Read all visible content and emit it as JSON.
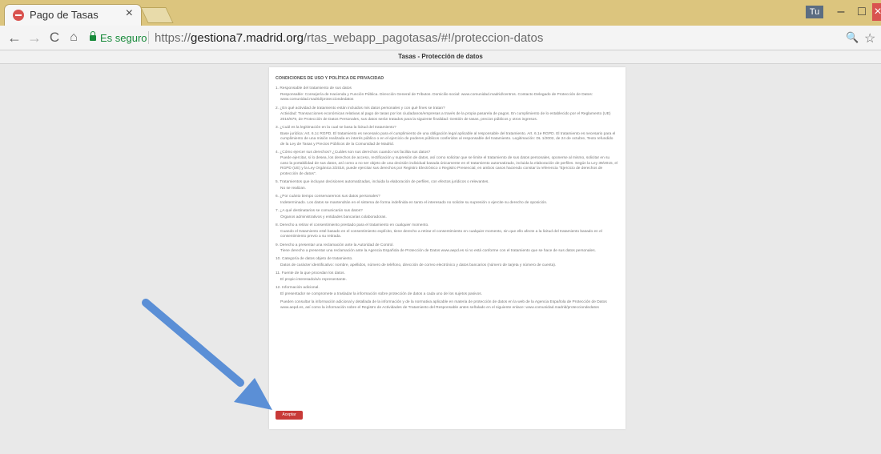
{
  "browser": {
    "tab_title": "Pago de Tasas",
    "tab_close": "×",
    "profile_label": "Tu",
    "window_minimize": "–",
    "window_maximize": "□",
    "window_close": "×",
    "nav": {
      "back": "←",
      "forward": "→",
      "reload": "C",
      "home": "⌂"
    },
    "secure_label": "Es seguro",
    "url_scheme": "https://",
    "url_host": "gestiona7.madrid.org",
    "url_path": "/rtas_webapp_pagotasas/#!/proteccion-datos",
    "zoom_icon": "🔍",
    "star_icon": "☆"
  },
  "page": {
    "header": "Tasas - Protección de datos",
    "doc_title": "CONDICIONES DE USO Y POLÍTICA DE PRIVACIDAD",
    "sections": [
      {
        "q": "1. Responsable del tratamiento de sus datos",
        "a": "Responsable: Consejería de Hacienda y Función Pública. Dirección General de Tributos. Domicilio social: www.comunidad.madrid/centros. Contacto Delegado de Protección de Datos: www.comunidad.madrid/protecciondedatos"
      },
      {
        "q": "2. ¿En qué actividad de tratamiento están incluidos mis datos personales y con qué fines se tratan?",
        "a": "Actividad: Transacciones económicas relativas al pago de tasas por los ciudadanos/empresas a través de la propia pasarela de pagos. En cumplimiento de lo establecido por el Reglamento (UE) 2016/679, de Protección de Datos Personales, sus datos serán tratados para la siguiente finalidad: Gestión de tasas, precios públicos y otros ingresos."
      },
      {
        "q": "3. ¿Cuál es la legitimación en la cual se basa la licitud del tratamiento?",
        "a": "Base jurídica: Art. 6.1c RGPD. El tratamiento es necesario para el cumplimiento de una obligación legal aplicable al responsable del tratamiento. Art. 6.1e RGPD. El tratamiento es necesario para el cumplimiento de una misión realizada en interés público o en el ejercicio de poderes públicos conferidos al responsable del tratamiento. Legitimación: DL 1/2002, de 24 de octubre, Texto refundido de la Ley de Tasas y Precios Públicos de la Comunidad de Madrid."
      },
      {
        "q": "4. ¿Cómo ejercer sus derechos? ¿Cuáles son sus derechos cuando nos facilita sus datos?",
        "a": "Puede ejercitar, si lo desea, los derechos de acceso, rectificación y supresión de datos, así como solicitar que se limite el tratamiento de sus datos personales, oponerse al mismo, solicitar en su caso la portabilidad de sus datos, así como a no ser objeto de una decisión individual basada únicamente en el tratamiento automatizado, incluida la elaboración de perfiles. Según la Ley 39/2015, el RGPD (UE) y la Ley Orgánica 3/2018, puede ejercitar sus derechos por Registro Electrónico o Registro Presencial, en ambos casos haciendo constar la referencia \"Ejercicio de derechos de protección de datos\"."
      },
      {
        "q": "5. Tratamientos que incluyan decisiones automatizadas, incluida la elaboración de perfiles, con efectos jurídicos o relevantes.",
        "a": "No se realizan."
      },
      {
        "q": "6. ¿Por cuánto tiempo conservaremos sus datos personales?",
        "a": "Indeterminado. Los datos se mantendrán en el sistema de forma indefinida en tanto el interesado no solicite su supresión o ejercite su derecho de oposición."
      },
      {
        "q": "7. ¿A qué destinatarios se comunicarán sus datos?",
        "a": "Órganos administrativos y entidades bancarias colaboradoras."
      },
      {
        "q": "8. Derecho a retirar el consentimiento prestado para el tratamiento en cualquier momento.",
        "a": "Cuando el tratamiento esté basado en el consentimiento explícito, tiene derecho a retirar el consentimiento en cualquier momento, sin que ello afecte a la licitud del tratamiento basado en el consentimiento previo a su retirada."
      },
      {
        "q": "9. Derecho a presentar una reclamación ante la Autoridad de Control.",
        "a": "Tiene derecho a presentar una reclamación ante la Agencia Española de Protección de Datos www.aepd.es si no está conforme con el tratamiento que se hace de sus datos personales."
      },
      {
        "q": "10. Categoría de datos objeto de tratamiento.",
        "a": "Datos de carácter identificativo: nombre, apellidos, número de teléfono, dirección de correo electrónico y datos bancarios (número de tarjeta y número de cuenta)."
      },
      {
        "q": "11. Fuente de la que procedan los datos.",
        "a": "El propio interesado/a/o representante."
      },
      {
        "q": "12. Información adicional.",
        "a": "El presentador se compromete a trasladar la información sobre protección de datos a cada uno de los sujetos pasivos."
      },
      {
        "q": "",
        "a": "Pueden consultar la información adicional y detallada de la información y de la normativa aplicable en materia de protección de datos en la web de la Agencia Española de Protección de Datos www.aepd.es, así como la información sobre el Registro de Actividades de Tratamiento del Responsable antes señalado en el siguiente enlace: www.comunidad.madrid/protecciondedatos"
      }
    ],
    "accept_button": "Aceptar"
  },
  "colors": {
    "tabbar": "#dcc57e",
    "accept": "#c83a38",
    "arrow": "#5b8fd6"
  }
}
